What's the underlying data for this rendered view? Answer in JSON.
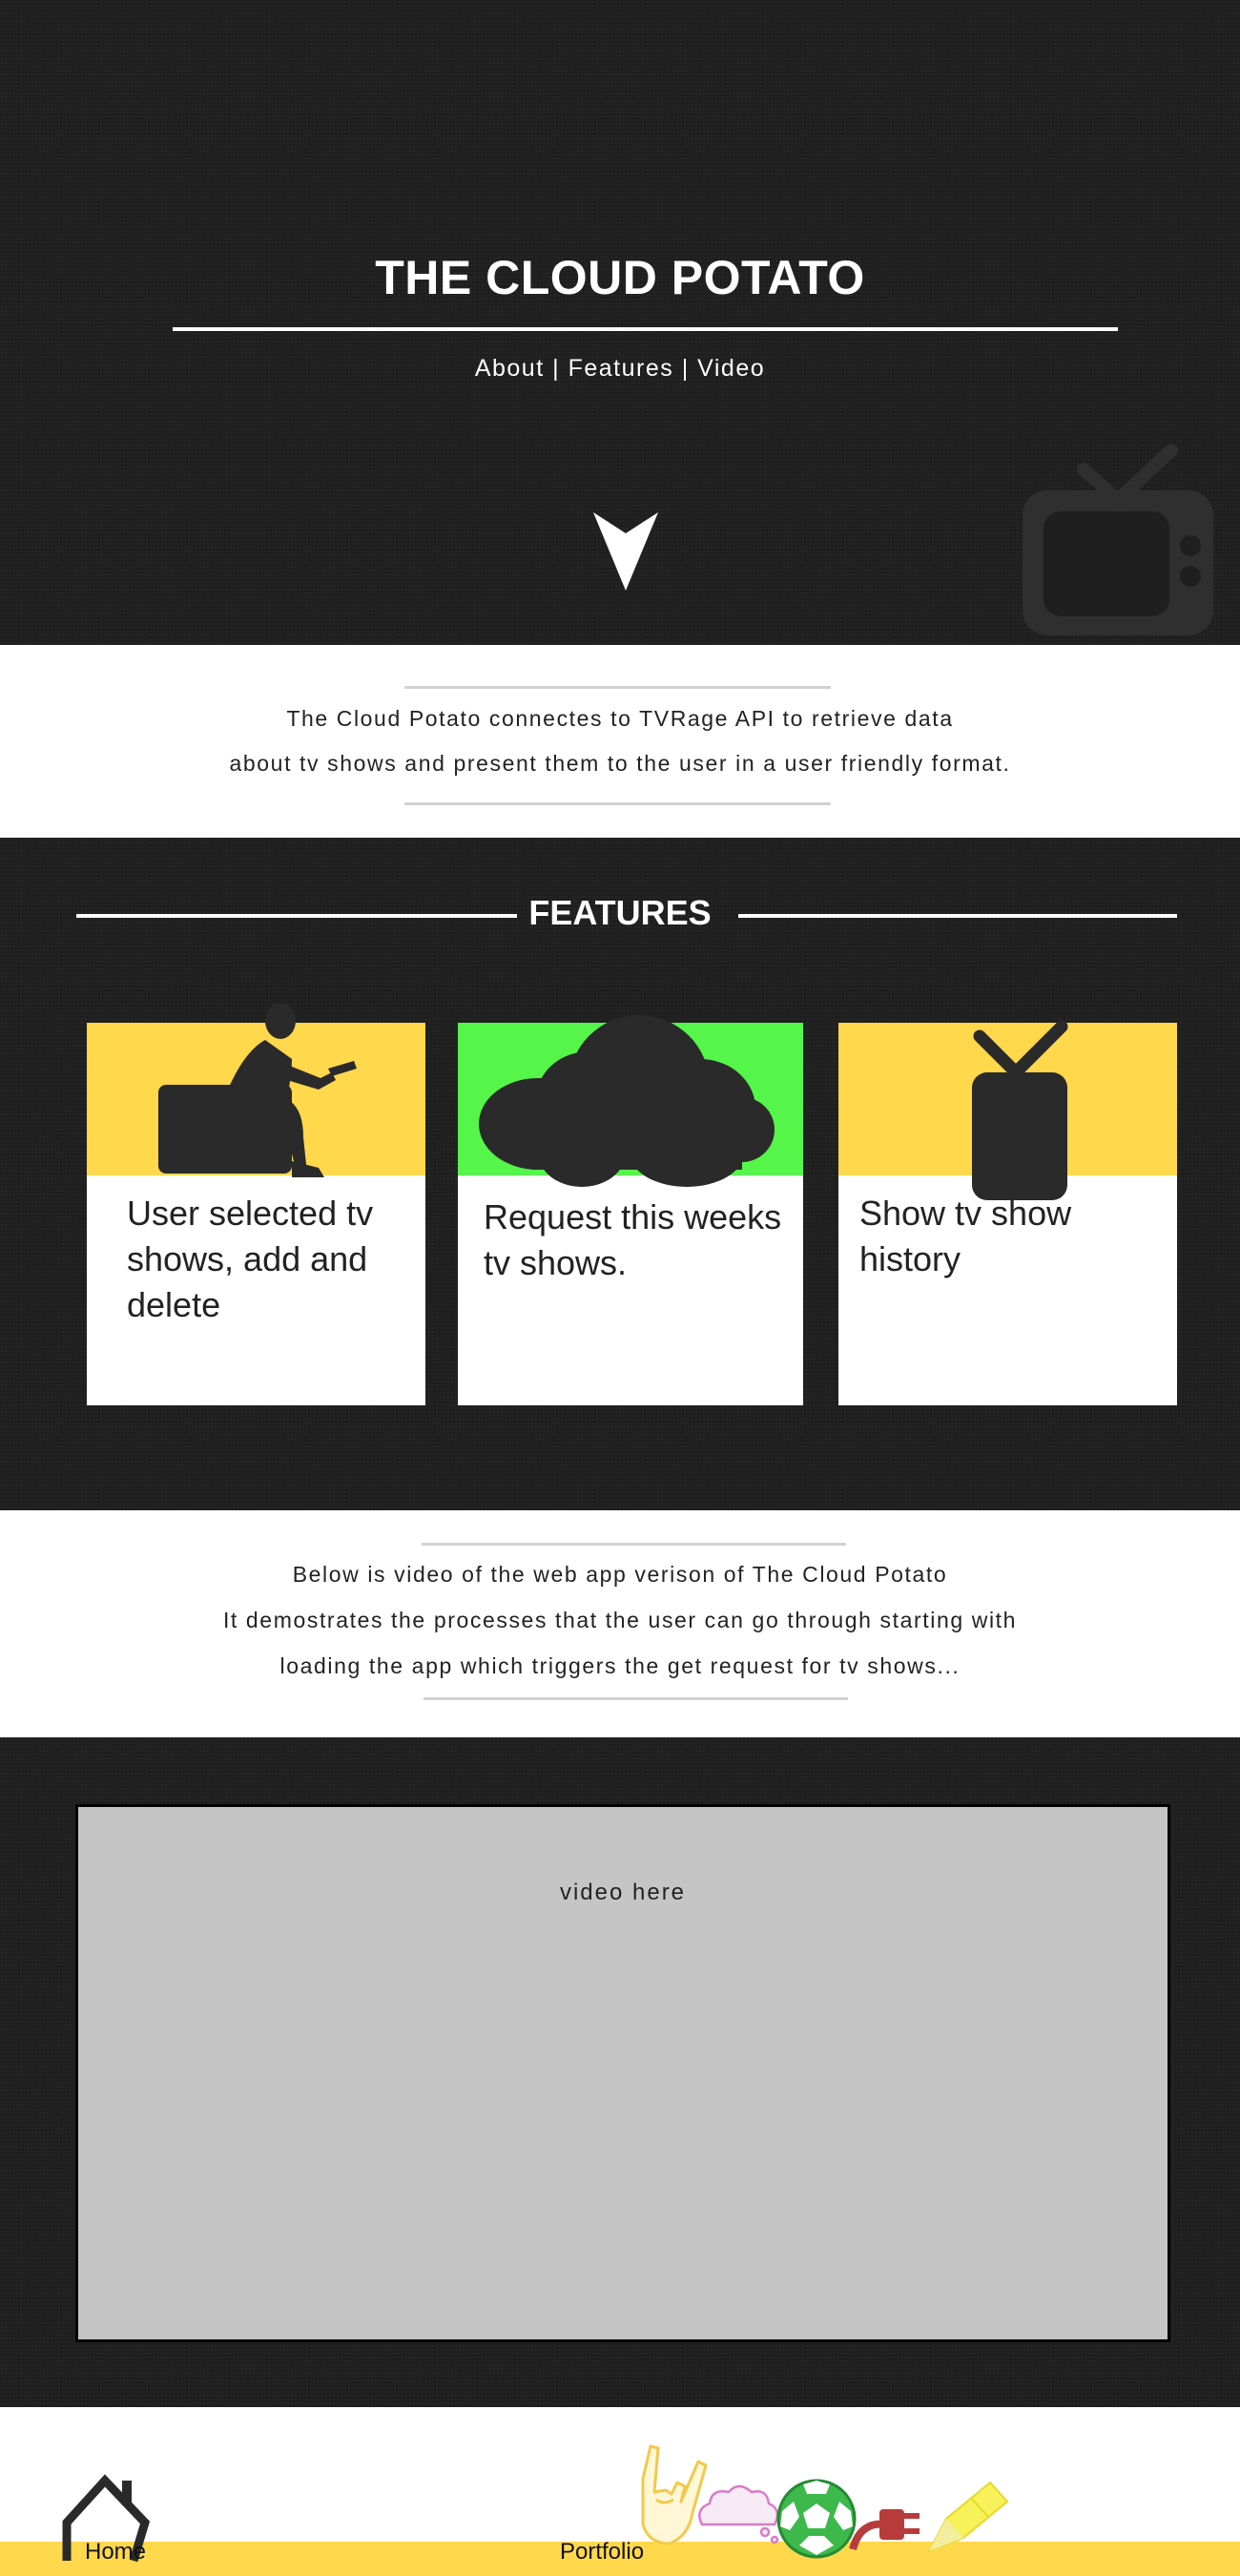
{
  "hero": {
    "title": "THE CLOUD POTATO",
    "nav": [
      {
        "label": "About"
      },
      {
        "label": "Features"
      },
      {
        "label": "Video"
      }
    ],
    "separator": "|",
    "scroll_icon": "down-arrow-icon",
    "watermark_icon": "tv-icon"
  },
  "about": {
    "lines": [
      "The Cloud Potato connectes to TVRage API to retrieve data",
      "about tv shows and present them to the user in a user friendly format."
    ]
  },
  "features": {
    "heading": "FEATURES",
    "cards": [
      {
        "text_lines": [
          "User selected tv",
          "shows, add and",
          "delete"
        ],
        "accent": "#ffd84c",
        "icon": "person-watching-tv-icon"
      },
      {
        "text_lines": [
          "Request this weeks",
          "tv shows."
        ],
        "accent": "#55f54a",
        "icon": "cloud-icon"
      },
      {
        "text_lines": [
          "Show tv show",
          "history"
        ],
        "accent": "#ffd84c",
        "icon": "tv-antenna-icon"
      }
    ]
  },
  "video_intro": {
    "lines": [
      "Below is video of the web app verison of The Cloud Potato",
      "It demostrates the processes that the user can go through starting with",
      "loading the app which triggers the get request for tv shows..."
    ]
  },
  "video": {
    "placeholder": "video here"
  },
  "footer": {
    "home_label": "Home",
    "portfolio_label": "Portfolio",
    "home_icon": "house-icon",
    "portfolio_icons": [
      "rock-hand-icon",
      "cloud-icon",
      "soccer-ball-icon",
      "plug-icon",
      "pencil-icon"
    ],
    "bar_color": "#ffd84c"
  },
  "colors": {
    "dark_bg": "#1f1f1f",
    "yellow": "#ffd84c",
    "green": "#55f54a",
    "video_grey": "#c6c5c6"
  }
}
